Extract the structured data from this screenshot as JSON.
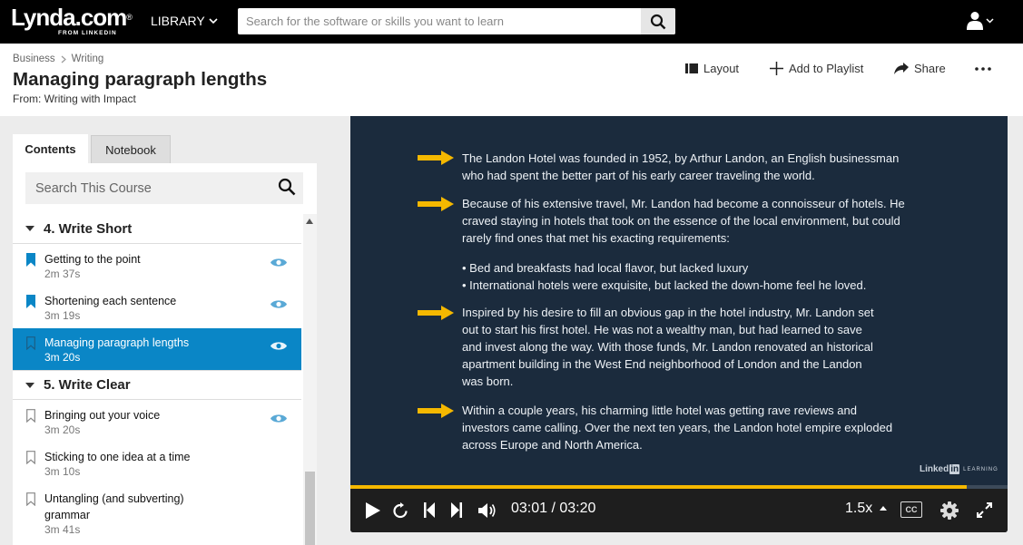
{
  "nav": {
    "logo_main": "Lynda.com",
    "logo_mark": "®",
    "logo_sub": "FROM LINKEDIN",
    "library_label": "LIBRARY",
    "search_placeholder": "Search for the software or skills you want to learn"
  },
  "header": {
    "breadcrumb": [
      "Business",
      "Writing"
    ],
    "title": "Managing paragraph lengths",
    "from": "From: Writing with Impact",
    "actions": {
      "layout": "Layout",
      "playlist": "Add to Playlist",
      "share": "Share"
    }
  },
  "sidebar": {
    "tabs": {
      "contents": "Contents",
      "notebook": "Notebook"
    },
    "search_placeholder": "Search This Course",
    "sections": [
      {
        "label": "4. Write Short"
      },
      {
        "label": "5. Write Clear"
      }
    ],
    "items": [
      {
        "title": "Getting to the point",
        "duration": "2m 37s"
      },
      {
        "title": "Shortening each sentence",
        "duration": "3m 19s"
      },
      {
        "title": "Managing paragraph lengths",
        "duration": "3m 20s"
      },
      {
        "title": "Bringing out your voice",
        "duration": "3m 20s"
      },
      {
        "title": "Sticking to one idea at a time",
        "duration": "3m 10s"
      },
      {
        "title": "Untangling (and subverting) grammar",
        "duration": "3m 41s"
      }
    ]
  },
  "video": {
    "paragraphs": [
      [
        "The Landon Hotel was founded in 1952, by Arthur Landon, an English businessman",
        "who had spent the better part of his early career traveling the world."
      ],
      [
        "Because of his extensive travel, Mr. Landon had become a connoisseur of hotels. He",
        "craved staying in hotels that took on the essence of the local environment, but could",
        "rarely find ones that met his exacting requirements:"
      ],
      [
        "• Bed and breakfasts had local flavor, but lacked luxury",
        "• International hotels were exquisite, but lacked the down-home feel he loved."
      ],
      [
        "Inspired by his desire to fill an obvious gap in the hotel industry, Mr. Landon set",
        "out to start his first hotel. He was not a wealthy man, but had learned to save",
        "and invest along the way. With those funds, Mr. Landon renovated an historical",
        "apartment building in the West End neighborhood of London and the Landon",
        "was born."
      ],
      [
        "Within a couple years, his charming little hotel was getting rave reviews and",
        "investors came calling. Over the next ten years, the Landon hotel empire exploded",
        "across Europe and North America."
      ]
    ],
    "watermark_brand": "Linked",
    "watermark_in": "in",
    "watermark_sub": "LEARNING",
    "progress": 0.9375,
    "timecode": "03:01 / 03:20",
    "speed": "1.5x",
    "cc_label": "CC",
    "accent_color": "#f5b800",
    "active_item_color": "#0a86c6"
  }
}
